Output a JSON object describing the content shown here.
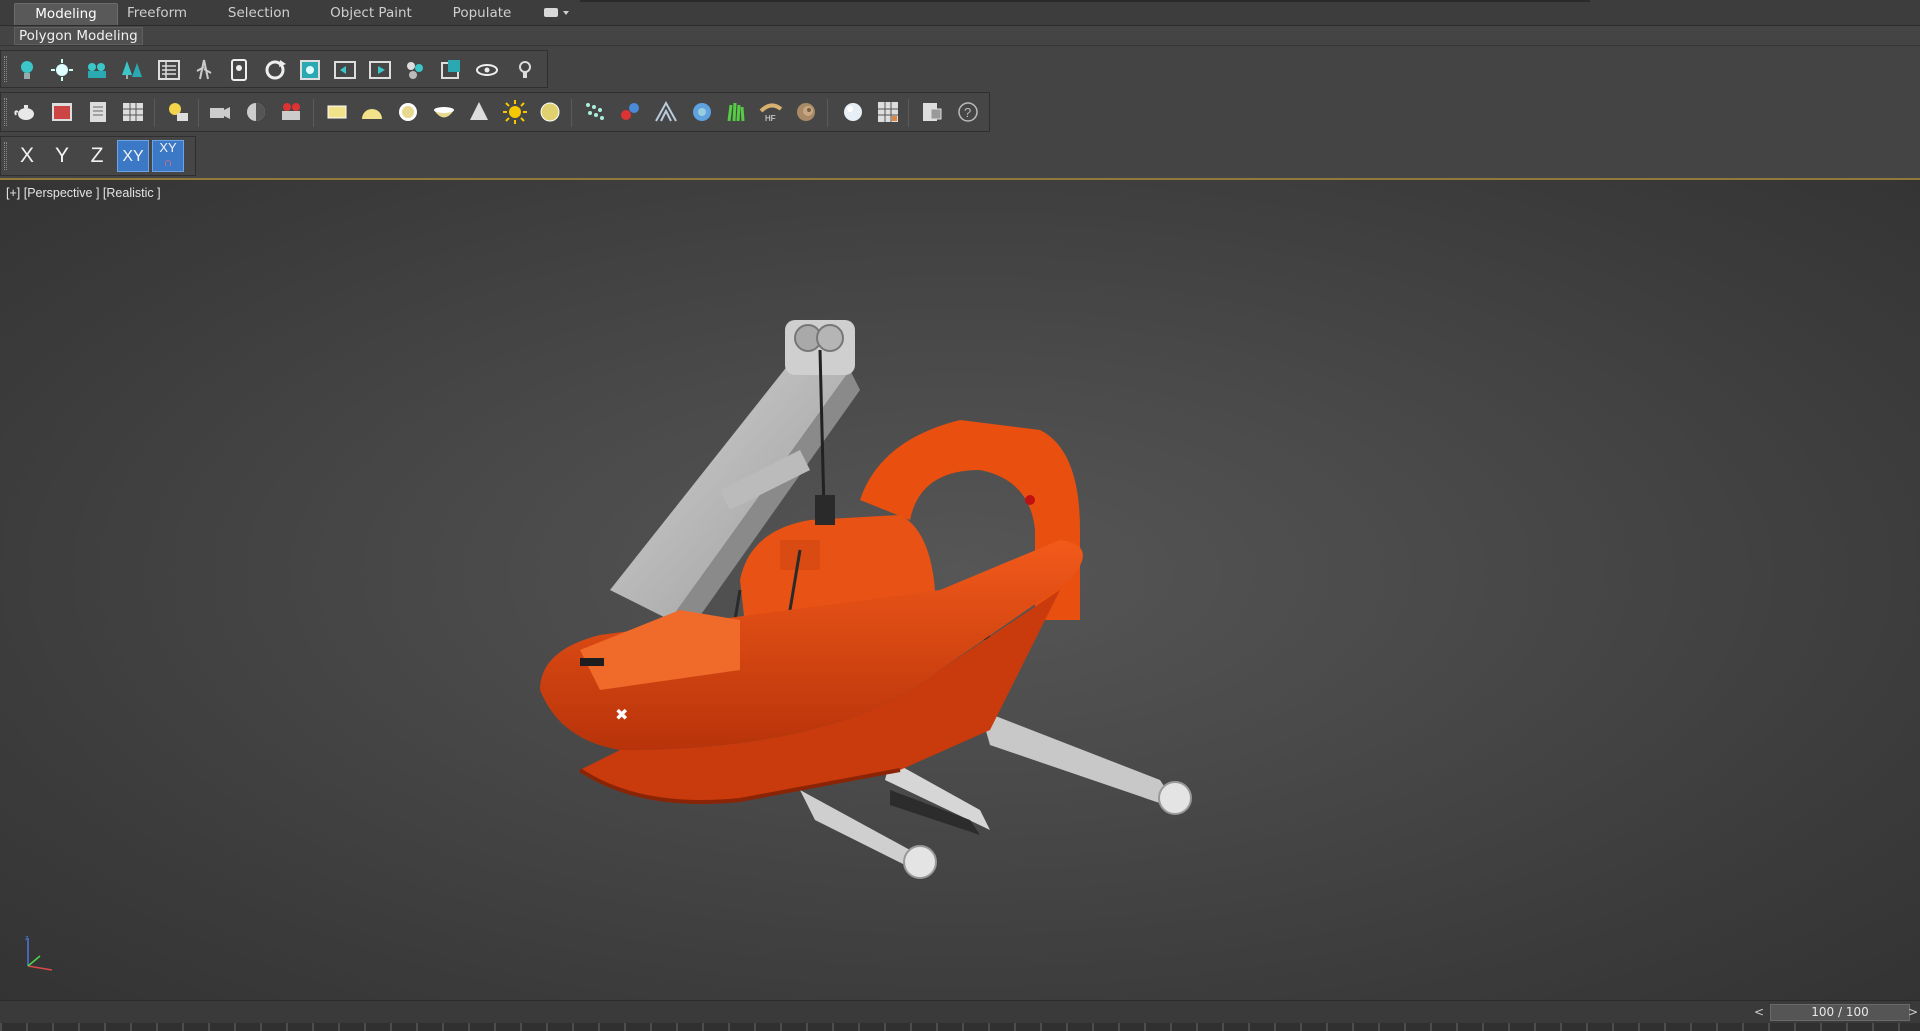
{
  "ribbon": {
    "tabs": [
      {
        "label": "Modeling",
        "active": true
      },
      {
        "label": "Freeform",
        "active": false
      },
      {
        "label": "Selection",
        "active": false
      },
      {
        "label": "Object Paint",
        "active": false
      },
      {
        "label": "Populate",
        "active": false
      }
    ],
    "panel_label": "Polygon Modeling"
  },
  "toolbar1": {
    "icons": [
      "light-bulb-icon",
      "sunburst-icon",
      "camera-group-icon",
      "tree-icon",
      "list-panel-icon",
      "foliage-icon",
      "portrait-icon",
      "rotate-icon",
      "render-frame-icon",
      "move-frame-icon",
      "film-frame-icon",
      "cluster-icon",
      "box-frame-icon",
      "eye-icon",
      "small-light-icon"
    ]
  },
  "toolbar2": {
    "icons": [
      "teapot-icon",
      "render-window-icon",
      "document-icon",
      "grid-table-icon",
      "light-lister-icon",
      "camera-icon",
      "hemisphere-icon",
      "video-camera-icon",
      "rectangle-icon",
      "dome-icon",
      "sphere-ring-icon",
      "bowl-icon",
      "cone-icon",
      "sun-icon",
      "disc-icon",
      "particles-icon",
      "capsule-icon",
      "tent-icon",
      "gear-sphere-icon",
      "grass-icon",
      "hf-icon",
      "nautilus-icon",
      "material-sphere-icon",
      "material-grid-icon",
      "render-setup-icon",
      "help-icon"
    ]
  },
  "axis_constraints": {
    "x": "X",
    "y": "Y",
    "z": "Z",
    "xy": "XY",
    "xy_alt": "XY"
  },
  "viewport": {
    "label": "[+] [Perspective ] [Realistic ]",
    "model_color": "#e0480f",
    "background": "#444444"
  },
  "time_slider": {
    "left_arrow": "<",
    "value": "100 / 100",
    "right_arrow": ">"
  },
  "colors": {
    "accent_blue": "#3b78c6",
    "viewport_border": "#8f7a3a"
  }
}
